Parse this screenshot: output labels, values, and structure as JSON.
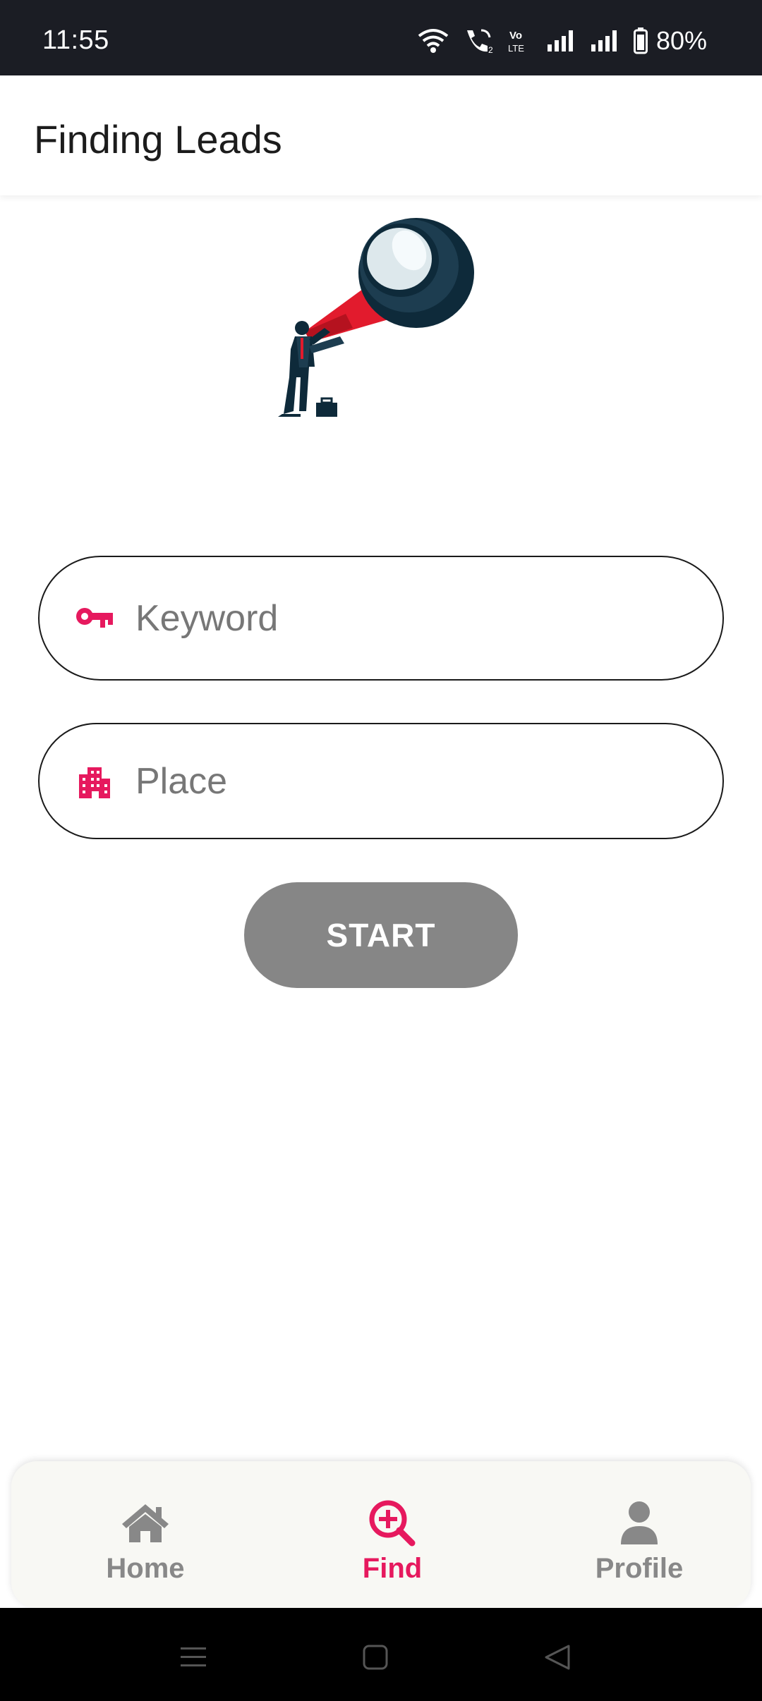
{
  "status_bar": {
    "time": "11:55",
    "battery": "80%",
    "icons": [
      "wifi-icon",
      "wifi-calling-icon",
      "volte-icon",
      "signal-icon",
      "signal-icon",
      "battery-icon"
    ]
  },
  "app_bar": {
    "title": "Finding Leads"
  },
  "illustration": {
    "icon": "businessman-telescope-illustration"
  },
  "form": {
    "keyword": {
      "placeholder": "Keyword",
      "value": "",
      "icon": "key-icon"
    },
    "place": {
      "placeholder": "Place",
      "value": "",
      "icon": "building-icon"
    },
    "start_label": "START"
  },
  "bottom_nav": {
    "items": [
      {
        "label": "Home",
        "icon": "home-icon",
        "active": false
      },
      {
        "label": "Find",
        "icon": "zoom-in-icon",
        "active": true
      },
      {
        "label": "Profile",
        "icon": "person-icon",
        "active": false
      }
    ]
  },
  "system_nav": {
    "buttons": [
      "menu-icon",
      "home-square-icon",
      "back-triangle-icon"
    ]
  },
  "colors": {
    "accent": "#e6195e",
    "button_disabled": "#868686",
    "inactive": "#888888",
    "status_bar": "#1b1d24"
  }
}
